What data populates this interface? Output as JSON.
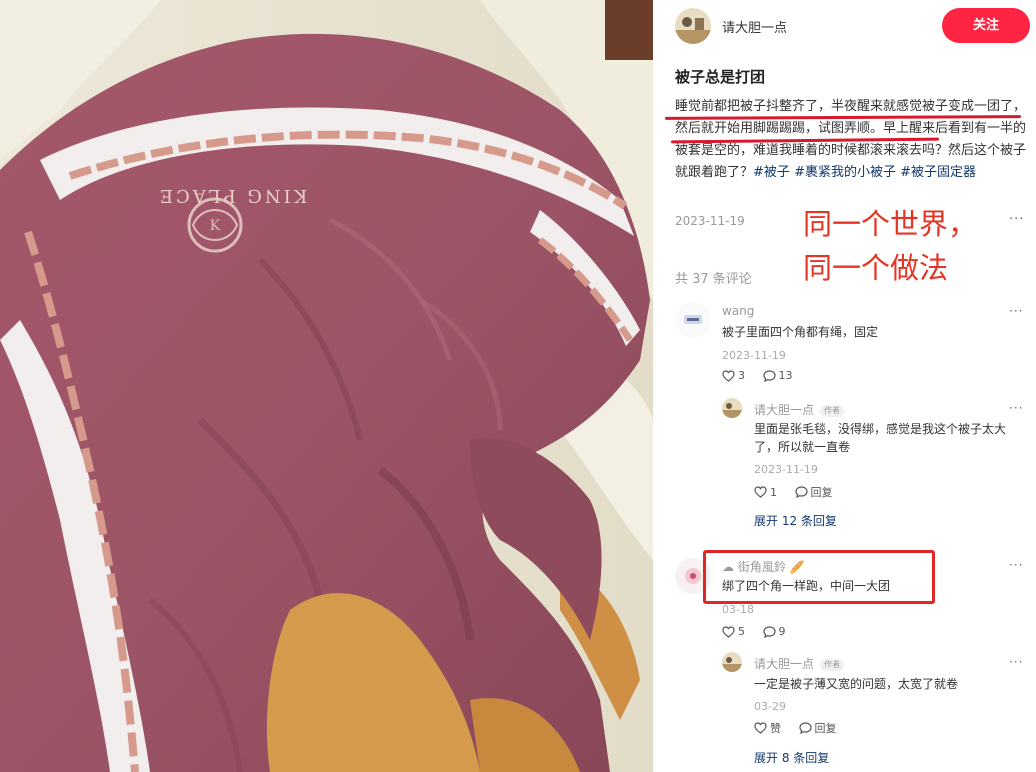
{
  "author": {
    "name": "请大胆一点",
    "follow_label": "关注"
  },
  "post": {
    "title": "被子总是打团",
    "body": "睡觉前都把被子抖整齐了，半夜醒来就感觉被子变成一团了，然后就开始用脚踢踢踢，试图弄顺。早上醒来后看到有一半的被套是空的，难道我睡着的时候都滚来滚去吗？然后这个被子就跟着跑了？",
    "tags": [
      "#被子",
      "#裹紧我的小被子",
      "#被子固定器"
    ],
    "date": "2023-11-19",
    "more": "···"
  },
  "photo": {
    "duvet_print_text": "KING PLACE"
  },
  "overlay": {
    "line1": "同一个世界，",
    "line2": "同一个做法"
  },
  "comments_header": {
    "count_label": "共 37 条评论"
  },
  "comments": [
    {
      "user": "wang",
      "text": "被子里面四个角都有绳，固定",
      "date": "2023-11-19",
      "likes": "3",
      "replies": "13",
      "more": "···"
    },
    {
      "user": "请大胆一点",
      "badge": "作者",
      "text": "里面是张毛毯，没得绑，感觉是我这个被子太大了，所以就一直卷",
      "date": "2023-11-19",
      "likes": "1",
      "reply_label": "回复",
      "more": "···",
      "expand_label": "展开 12 条回复"
    },
    {
      "user": "街角風鈴",
      "text": "绑了四个角一样跑，中间一大团",
      "date": "03-18",
      "likes": "5",
      "replies": "9",
      "more": "···"
    },
    {
      "user": "请大胆一点",
      "badge": "作者",
      "text": "一定是被子薄又宽的问题，太宽了就卷",
      "date": "03-29",
      "like_label": "赞",
      "reply_label": "回复",
      "more": "···",
      "expand_label": "展开 8 条回复"
    }
  ],
  "colors": {
    "follow": "#ff2442",
    "tag": "#13386c",
    "annotation_red": "#e02626",
    "duvet": "#a45d6e",
    "blanket_orange": "#d69a4c"
  }
}
